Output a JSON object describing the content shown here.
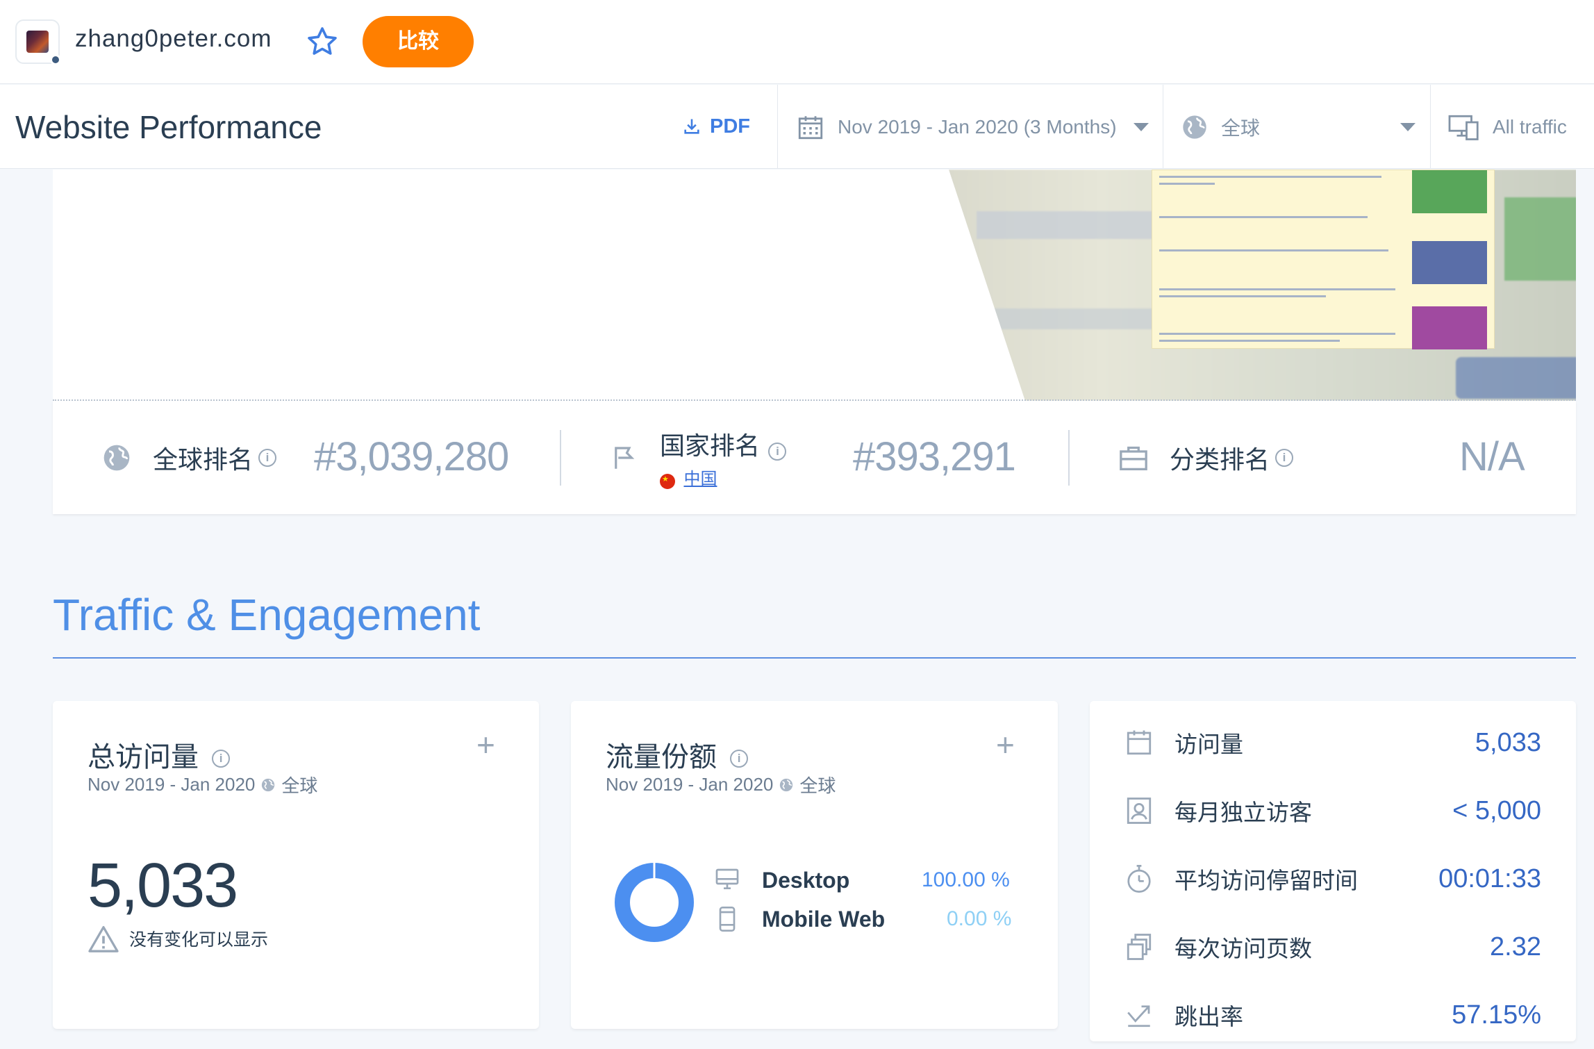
{
  "site": {
    "domain": "zhang0peter.com",
    "compare_label": "比较"
  },
  "header": {
    "title": "Website Performance",
    "pdf_label": "PDF",
    "date_range": "Nov 2019 - Jan 2020 (3 Months)",
    "region": "全球",
    "traffic": "All traffic"
  },
  "ranks": {
    "global": {
      "label": "全球排名",
      "value": "#3,039,280"
    },
    "country": {
      "label": "国家排名",
      "country": "中国",
      "value": "#393,291"
    },
    "category": {
      "label": "分类排名",
      "value": "N/A"
    }
  },
  "section": {
    "title": "Traffic & Engagement"
  },
  "total_visits": {
    "title": "总访问量",
    "period": "Nov 2019 - Jan 2020",
    "region": "全球",
    "value": "5,033",
    "note": "没有变化可以显示"
  },
  "traffic_share": {
    "title": "流量份额",
    "period": "Nov 2019 - Jan 2020",
    "region": "全球",
    "devices": [
      {
        "name": "Desktop",
        "value": "100.00 %",
        "share": 1.0,
        "color": "#4c8ff0"
      },
      {
        "name": "Mobile Web",
        "value": "0.00 %",
        "share": 0.0,
        "color": "#8fd0f5"
      }
    ]
  },
  "engagement": [
    {
      "icon": "calendar-icon",
      "label": "访问量",
      "value": "5,033"
    },
    {
      "icon": "visitor-icon",
      "label": "每月独立访客",
      "value": "< 5,000"
    },
    {
      "icon": "stopwatch-icon",
      "label": "平均访问停留时间",
      "value": "00:01:33"
    },
    {
      "icon": "pages-icon",
      "label": "每次访问页数",
      "value": "2.32"
    },
    {
      "icon": "bounce-icon",
      "label": "跳出率",
      "value": "57.15%"
    }
  ],
  "colors": {
    "accent": "#4f8fe6",
    "compare": "#ff7f00",
    "metric_value": "#3567c4"
  }
}
